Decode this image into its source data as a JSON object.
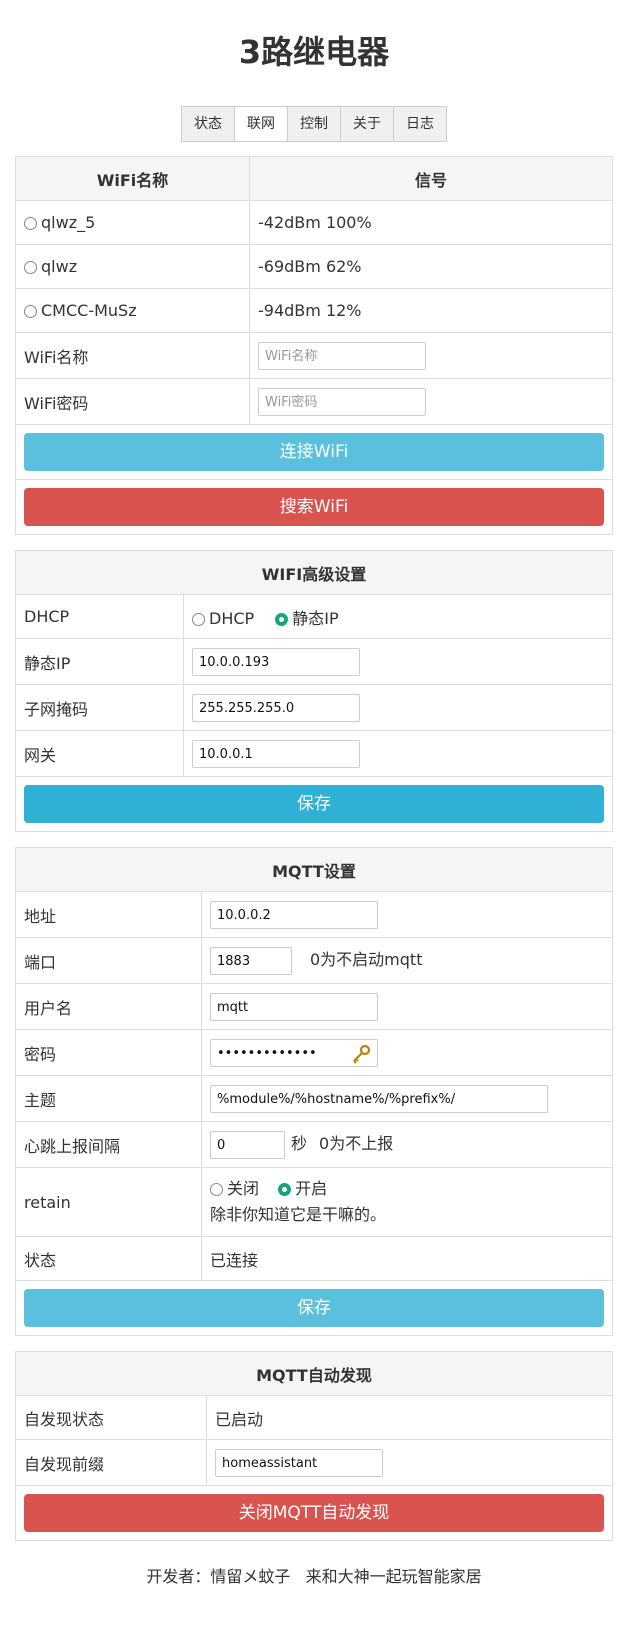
{
  "title": "3路继电器",
  "tabs": [
    "状态",
    "联网",
    "控制",
    "关于",
    "日志"
  ],
  "wifi": {
    "col_name": "WiFi名称",
    "col_signal": "信号",
    "networks": [
      {
        "ssid": "qlwz_5",
        "signal": "-42dBm 100%"
      },
      {
        "ssid": "qlwz",
        "signal": "-69dBm 62%"
      },
      {
        "ssid": "CMCC-MuSz",
        "signal": "-94dBm 12%"
      }
    ],
    "name_label": "WiFi名称",
    "name_placeholder": "WiFi名称",
    "pass_label": "WiFi密码",
    "pass_placeholder": "WiFi密码",
    "connect_button": "连接WiFi",
    "scan_button": "搜索WiFi"
  },
  "advanced": {
    "header": "WIFI高级设置",
    "dhcp_label": "DHCP",
    "dhcp_option": "DHCP",
    "static_option": "静态IP",
    "ip_label": "静态IP",
    "ip_value": "10.0.0.193",
    "mask_label": "子网掩码",
    "mask_value": "255.255.255.0",
    "gw_label": "网关",
    "gw_value": "10.0.0.1",
    "save_button": "保存"
  },
  "mqtt": {
    "header": "MQTT设置",
    "addr_label": "地址",
    "addr_value": "10.0.0.2",
    "port_label": "端口",
    "port_value": "1883",
    "port_hint": "0为不启动mqtt",
    "user_label": "用户名",
    "user_value": "mqtt",
    "pass_label": "密码",
    "pass_value": "•••••••••••••",
    "topic_label": "主题",
    "topic_value": "%module%/%hostname%/%prefix%/",
    "heartbeat_label": "心跳上报间隔",
    "heartbeat_value": "0",
    "heartbeat_unit": "秒",
    "heartbeat_hint": "0为不上报",
    "retain_label": "retain",
    "retain_off": "关闭",
    "retain_on": "开启",
    "retain_hint": "除非你知道它是干嘛的。",
    "status_label": "状态",
    "status_value": "已连接",
    "save_button": "保存"
  },
  "discovery": {
    "header": "MQTT自动发现",
    "state_label": "自发现状态",
    "state_value": "已启动",
    "prefix_label": "自发现前缀",
    "prefix_value": "homeassistant",
    "close_button": "关闭MQTT自动发现"
  },
  "footer": "开发者：情留メ蚊子   来和大神一起玩智能家居",
  "colors": {
    "info": "#5bc0de",
    "danger": "#d9534f",
    "primary": "#31b0d5",
    "radio_on": "#1aa37a"
  }
}
